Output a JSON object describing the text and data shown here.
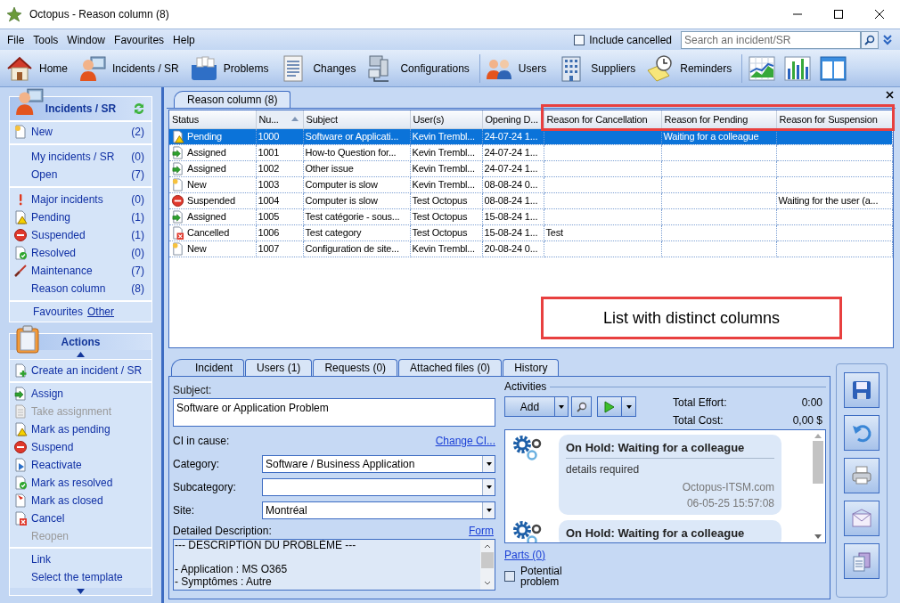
{
  "window": {
    "title": "Octopus - Reason column (8)"
  },
  "menu": [
    "File",
    "Tools",
    "Window",
    "Favourites",
    "Help"
  ],
  "include_cancelled": {
    "label": "Include cancelled",
    "checked": false
  },
  "search": {
    "placeholder": "Search an incident/SR"
  },
  "toolbar": [
    {
      "label": "Home",
      "kind": "home",
      "separator_after": false
    },
    {
      "label": "Incidents / SR",
      "kind": "incidents",
      "separator_after": false
    },
    {
      "label": "Problems",
      "kind": "problems",
      "separator_after": false
    },
    {
      "label": "Changes",
      "kind": "changes",
      "separator_after": false
    },
    {
      "label": "Configurations",
      "kind": "configurations",
      "separator_after": true
    },
    {
      "label": "Users",
      "kind": "users",
      "separator_after": false
    },
    {
      "label": "Suppliers",
      "kind": "suppliers",
      "separator_after": false
    },
    {
      "label": "Reminders",
      "kind": "reminders",
      "separator_after": true
    },
    {
      "kind": "line-chart",
      "separator_after": false
    },
    {
      "kind": "bar-chart",
      "separator_after": false
    },
    {
      "kind": "layout",
      "separator_after": false
    }
  ],
  "incidents_panel": {
    "title": "Incidents / SR",
    "groups": [
      [
        {
          "label": "New",
          "count": "(2)",
          "kind": "new"
        }
      ],
      [
        {
          "label": "My incidents / SR",
          "count": "(0)"
        },
        {
          "label": "Open",
          "count": "(7)"
        }
      ],
      [
        {
          "label": "Major incidents",
          "count": "(0)",
          "kind": "major"
        },
        {
          "label": "Pending",
          "count": "(1)",
          "kind": "pending"
        },
        {
          "label": "Suspended",
          "count": "(1)",
          "kind": "suspended"
        },
        {
          "label": "Resolved",
          "count": "(0)",
          "kind": "resolved"
        },
        {
          "label": "Maintenance",
          "count": "(7)",
          "kind": "maintenance"
        },
        {
          "label": "Reason column",
          "count": "(8)"
        }
      ]
    ],
    "favourites": "Favourites",
    "other": "Other"
  },
  "actions_panel": {
    "title": "Actions",
    "groups": [
      [
        {
          "label": "Create an incident / SR",
          "kind": "create",
          "disabled": false
        }
      ],
      [
        {
          "label": "Assign",
          "kind": "assigned",
          "disabled": false
        },
        {
          "label": "Take assignment",
          "kind": "take",
          "disabled": true
        },
        {
          "label": "Mark as pending",
          "kind": "pending",
          "disabled": false
        },
        {
          "label": "Suspend",
          "kind": "suspended",
          "disabled": false
        },
        {
          "label": "Reactivate",
          "kind": "reactivate",
          "disabled": false
        },
        {
          "label": "Mark as resolved",
          "kind": "resolved",
          "disabled": false
        },
        {
          "label": "Mark as closed",
          "kind": "closed",
          "disabled": false
        },
        {
          "label": "Cancel",
          "kind": "cancelled",
          "disabled": false
        },
        {
          "label": "Reopen",
          "disabled": true
        }
      ],
      [
        {
          "label": "Link",
          "disabled": false
        },
        {
          "label": "Select the template",
          "disabled": false
        }
      ]
    ]
  },
  "list_tab": {
    "label": "Reason column (8)"
  },
  "table": {
    "columns": [
      {
        "label": "Status",
        "sorted": false
      },
      {
        "label": "Nu...",
        "sorted": true
      },
      {
        "label": "Subject",
        "sorted": false
      },
      {
        "label": "User(s)",
        "sorted": false
      },
      {
        "label": "Opening D...",
        "sorted": false
      },
      {
        "label": "Reason for Cancellation",
        "sorted": false
      },
      {
        "label": "Reason for Pending",
        "sorted": false
      },
      {
        "label": "Reason for Suspension",
        "sorted": false
      }
    ],
    "rows": [
      {
        "kind": "pending",
        "selected": true,
        "status": "Pending",
        "number": "1000",
        "subject": "Software or Applicati...",
        "users": "Kevin Trembl...",
        "opening": "24-07-24 1...",
        "pending_reason": "Waiting for a colleague"
      },
      {
        "kind": "assigned",
        "selected": false,
        "status": "Assigned",
        "number": "1001",
        "subject": "How-to Question for...",
        "users": "Kevin Trembl...",
        "opening": "24-07-24 1..."
      },
      {
        "kind": "assigned",
        "selected": false,
        "status": "Assigned",
        "number": "1002",
        "subject": "Other issue",
        "users": "Kevin Trembl...",
        "opening": "24-07-24 1..."
      },
      {
        "kind": "new",
        "selected": false,
        "status": "New",
        "number": "1003",
        "subject": "Computer is slow",
        "users": "Kevin Trembl...",
        "opening": "08-08-24 0..."
      },
      {
        "kind": "suspended",
        "selected": false,
        "status": "Suspended",
        "number": "1004",
        "subject": "Computer is slow",
        "users": "Test Octopus",
        "opening": "08-08-24 1...",
        "suspension_reason": "Waiting for the user (a..."
      },
      {
        "kind": "assigned",
        "selected": false,
        "status": "Assigned",
        "number": "1005",
        "subject": "Test catégorie - sous...",
        "users": "Test Octopus",
        "opening": "15-08-24 1..."
      },
      {
        "kind": "cancelled",
        "selected": false,
        "status": "Cancelled",
        "number": "1006",
        "subject": "Test category",
        "users": "Test Octopus",
        "opening": "15-08-24 1...",
        "cancellation_reason": "Test"
      },
      {
        "kind": "new",
        "selected": false,
        "status": "New",
        "number": "1007",
        "subject": "Configuration de site...",
        "users": "Kevin Trembl...",
        "opening": "20-08-24 0..."
      }
    ]
  },
  "annotation": {
    "callout": "List with distinct columns"
  },
  "detail": {
    "tabs": [
      {
        "label": "Incident",
        "selected": true
      },
      {
        "label": "Users (1)",
        "selected": false
      },
      {
        "label": "Requests (0)",
        "selected": false
      },
      {
        "label": "Attached files (0)",
        "selected": false
      },
      {
        "label": "History",
        "selected": false
      }
    ],
    "subject_label": "Subject:",
    "subject": "Software or Application Problem",
    "ci_label": "CI in cause:",
    "change_ci": "Change CI...",
    "fields": [
      {
        "label": "Category:",
        "value": "Software / Business Application"
      },
      {
        "label": "Subcategory:"
      },
      {
        "label": "Site:",
        "value": "Montréal"
      }
    ],
    "description_label": "Detailed Description:",
    "form_link": "Form",
    "description": [
      {
        "text": "--- DESCRIPTION DU PROBLÈME ---",
        "gap_before": false
      },
      {
        "text": "- Application : MS O365",
        "gap_before": true
      },
      {
        "text": "- Symptômes : Autre",
        "gap_before": false
      }
    ],
    "activities": {
      "title": "Activities",
      "add": "Add",
      "effort_label": "Total Effort:",
      "effort": "0:00",
      "cost_label": "Total Cost:",
      "cost": "0,00 $",
      "entries": [
        {
          "title": "On Hold: Waiting for a colleague",
          "body": "details required",
          "author": "Octopus-ITSM.com",
          "date": "06-05-25 15:57:08"
        },
        {
          "title": "On Hold: Waiting for a colleague"
        }
      ],
      "parts": "Parts (0)"
    },
    "potential_problem": {
      "label": "Potential problem",
      "checked": false
    }
  },
  "side_buttons": [
    {
      "kind": "save"
    },
    {
      "kind": "undo"
    },
    {
      "kind": "print"
    },
    {
      "kind": "mail"
    },
    {
      "kind": "copy"
    }
  ]
}
